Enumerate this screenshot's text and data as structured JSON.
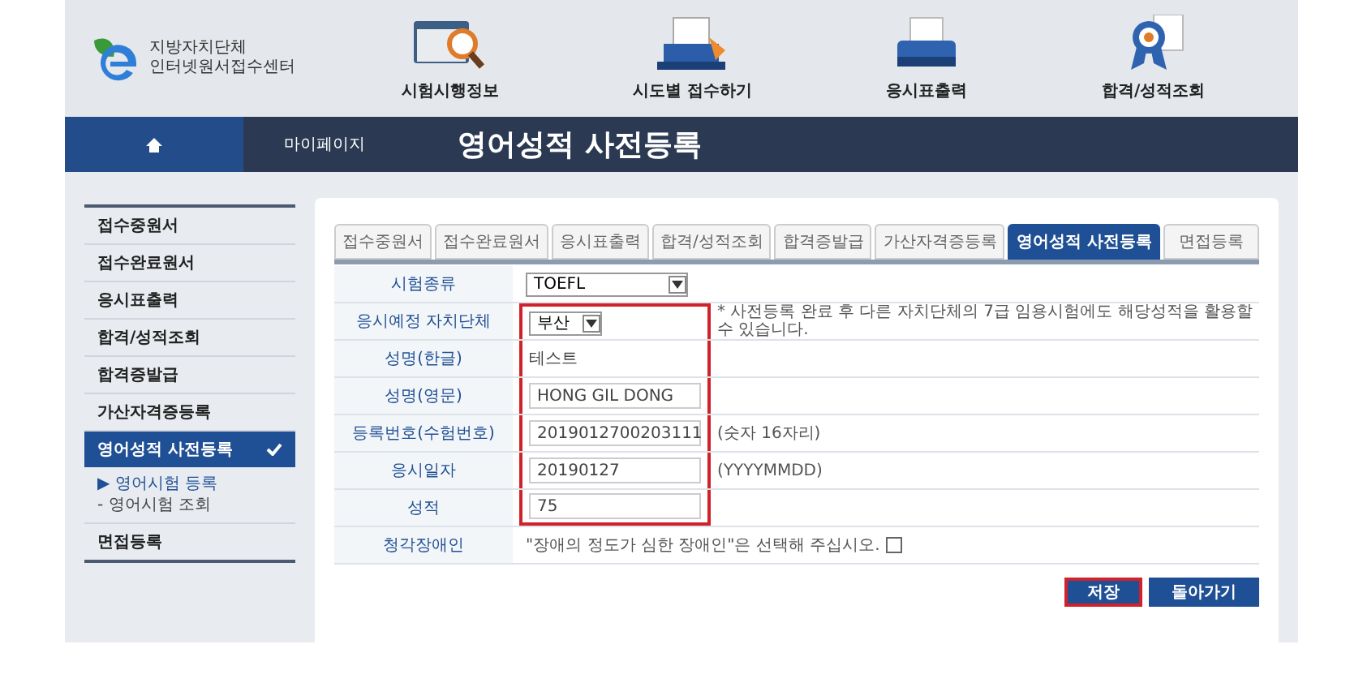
{
  "logo": {
    "line1": "지방자치단체",
    "line2": "인터넷원서접수센터"
  },
  "top_menu": [
    {
      "label": "시험시행정보",
      "kind": "search"
    },
    {
      "label": "시도별 접수하기",
      "kind": "laptop"
    },
    {
      "label": "응시표출력",
      "kind": "printer"
    },
    {
      "label": "합격/성적조회",
      "kind": "award"
    }
  ],
  "breadcrumb": {
    "section": "마이페이지",
    "title": "영어성적 사전등록"
  },
  "sidebar": {
    "items": [
      {
        "label": "접수중원서",
        "selected": false
      },
      {
        "label": "접수완료원서",
        "selected": false
      },
      {
        "label": "응시표출력",
        "selected": false
      },
      {
        "label": "합격/성적조회",
        "selected": false
      },
      {
        "label": "합격증발급",
        "selected": false
      },
      {
        "label": "가산자격증등록",
        "selected": false
      },
      {
        "label": "영어성적 사전등록",
        "selected": true,
        "children": [
          {
            "marker": "▶",
            "label": "영어시험 등록",
            "selected": true
          },
          {
            "marker": "-",
            "label": "영어시험 조회",
            "selected": false
          }
        ]
      },
      {
        "label": "면접등록",
        "selected": false
      }
    ]
  },
  "tabs": [
    {
      "label": "접수중원서",
      "selected": false
    },
    {
      "label": "접수완료원서",
      "selected": false
    },
    {
      "label": "응시표출력",
      "selected": false
    },
    {
      "label": "합격/성적조회",
      "selected": false
    },
    {
      "label": "합격증발급",
      "selected": false
    },
    {
      "label": "가산자격증등록",
      "selected": false
    },
    {
      "label": "영어성적 사전등록",
      "selected": true
    },
    {
      "label": "면접등록",
      "selected": false
    }
  ],
  "form": [
    {
      "kind": "select",
      "label": "시험종류",
      "value": "TOEFL",
      "highlighted": false
    },
    {
      "kind": "select",
      "label": "응시예정 자치단체",
      "value": "부산",
      "note": "* 사전등록 완료 후 다른 자치단체의 7급 임용시험에도 해당성적을 활용할 수 있습니다.",
      "highlighted": true
    },
    {
      "kind": "text",
      "label": "성명(한글)",
      "value": "테스트",
      "highlighted": true
    },
    {
      "kind": "input",
      "label": "성명(영문)",
      "value": "HONG GIL DONG",
      "highlighted": true
    },
    {
      "kind": "input",
      "label": "등록번호(수험번호)",
      "value": "2019012700203111",
      "note": "(숫자 16자리)",
      "highlighted": true
    },
    {
      "kind": "input",
      "label": "응시일자",
      "value": "20190127",
      "note": "(YYYYMMDD)",
      "highlighted": true
    },
    {
      "kind": "input",
      "label": "성적",
      "value": "75",
      "highlighted": true
    },
    {
      "kind": "checkbox",
      "label": "청각장애인",
      "note": "\"장애의 정도가 심한 장애인\"은 선택해 주십시오.",
      "checked": false,
      "highlighted": false
    }
  ],
  "buttons": [
    {
      "label": "저장",
      "highlighted": true
    },
    {
      "label": "돌아가기",
      "highlighted": false
    }
  ]
}
